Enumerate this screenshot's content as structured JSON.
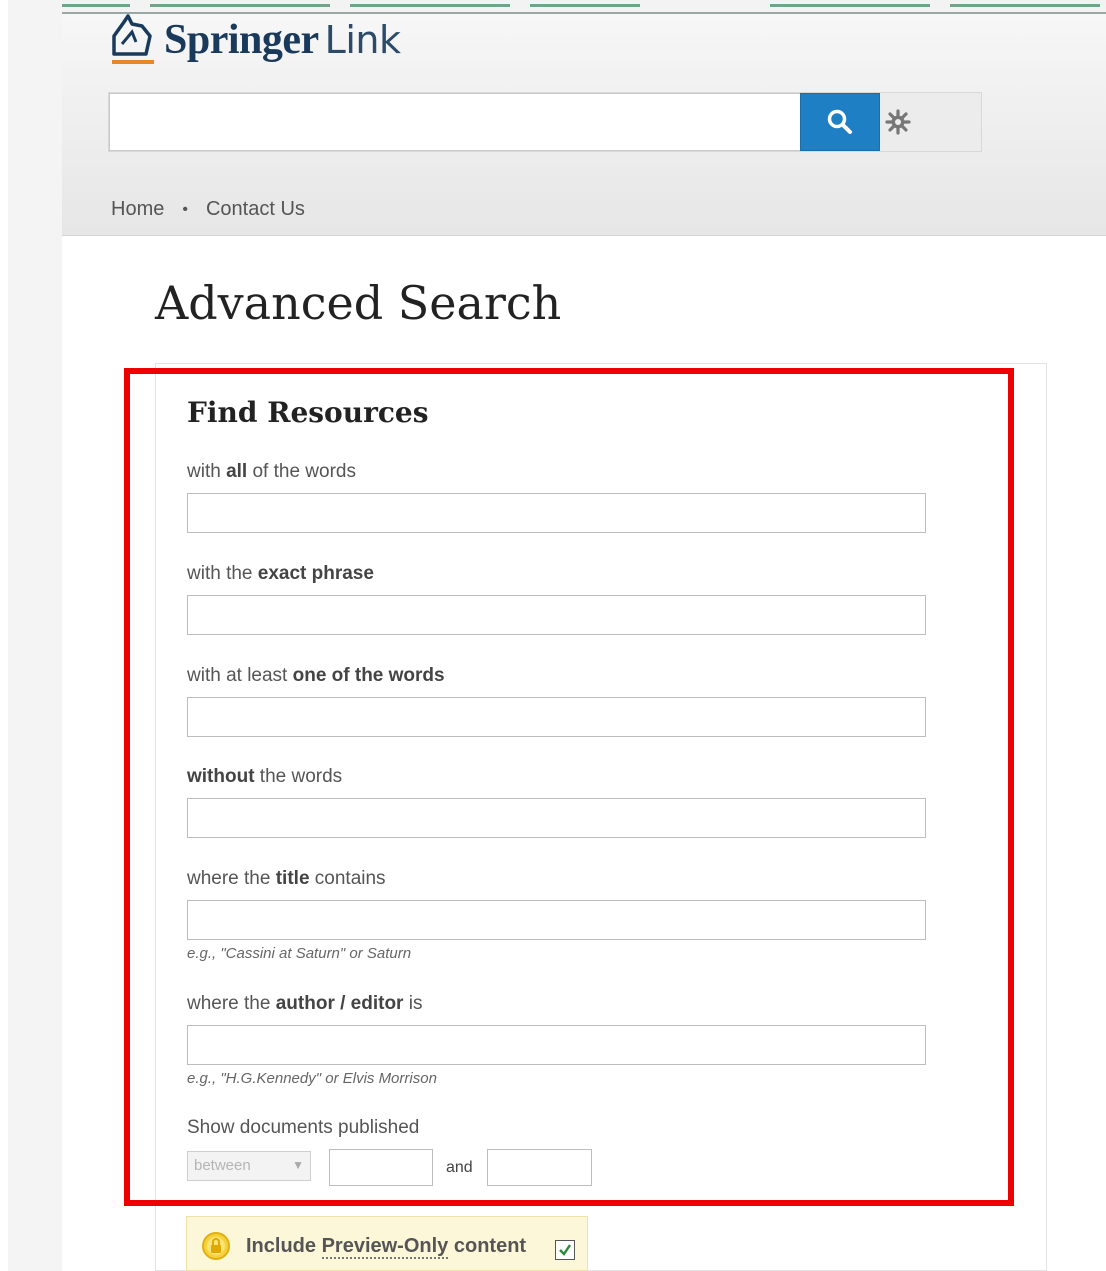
{
  "brand": {
    "name_bold": "Springer",
    "name_light": "Link"
  },
  "header": {
    "search_placeholder": "",
    "search_icon": "search-icon",
    "settings_icon": "gear-icon"
  },
  "nav": {
    "items": [
      "Home",
      "Contact Us"
    ],
    "separator": "•"
  },
  "page": {
    "title": "Advanced Search"
  },
  "form": {
    "section_title": "Find Resources",
    "fields": [
      {
        "pre": "with ",
        "bold": "all",
        "post": " of the words",
        "value": ""
      },
      {
        "pre": "with the ",
        "bold": "exact phrase",
        "post": "",
        "value": ""
      },
      {
        "pre": "with at least ",
        "bold": "one of the words",
        "post": "",
        "value": ""
      },
      {
        "pre": "",
        "bold": "without",
        "post": " the words",
        "value": ""
      },
      {
        "pre": "where the ",
        "bold": "title",
        "post": " contains",
        "value": "",
        "hint": "e.g., \"Cassini at Saturn\" or Saturn"
      },
      {
        "pre": "where the ",
        "bold": "author / editor",
        "post": " is",
        "value": "",
        "hint": "e.g., \"H.G.Kennedy\" or Elvis Morrison"
      }
    ],
    "date_label": "Show documents published",
    "date_mode": "between",
    "date_from": "",
    "and_label": "and",
    "date_to": ""
  },
  "preview": {
    "pre": "Include ",
    "link": "Preview-Only",
    "post": " content",
    "checked": true
  },
  "colors": {
    "accent_blue": "#1f7fc4",
    "highlight_red": "#ee0000",
    "preview_bg": "#fdf7d9",
    "brand_navy": "#1a3a5c",
    "brand_orange": "#e8862a"
  }
}
